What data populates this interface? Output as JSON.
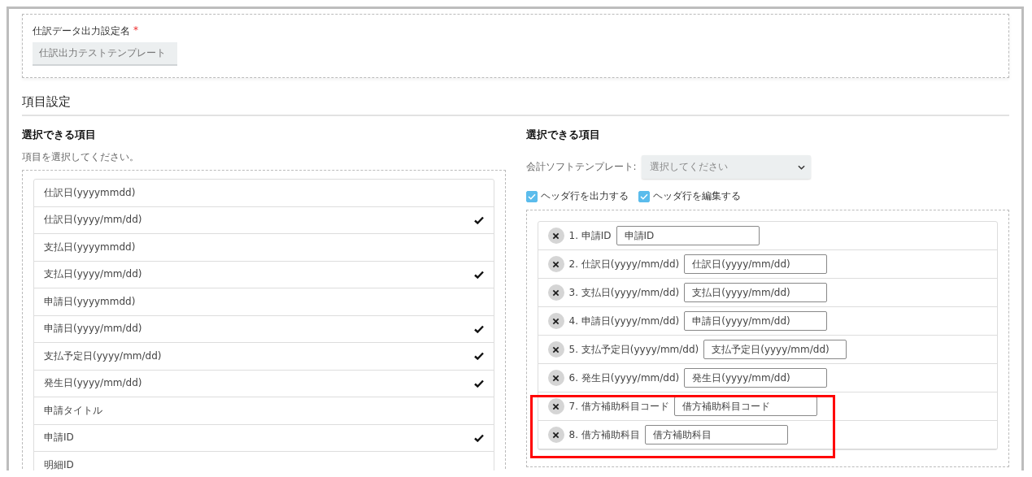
{
  "setting_name": {
    "label": "仕訳データ出力設定名",
    "required_mark": "*",
    "value": "仕訳出力テストテンプレート"
  },
  "section_title": "項目設定",
  "left": {
    "title": "選択できる項目",
    "hint": "項目を選択してください。",
    "items": [
      {
        "label": "仕訳日(yyyymmdd)",
        "checked": false
      },
      {
        "label": "仕訳日(yyyy/mm/dd)",
        "checked": true
      },
      {
        "label": "支払日(yyyymmdd)",
        "checked": false
      },
      {
        "label": "支払日(yyyy/mm/dd)",
        "checked": true
      },
      {
        "label": "申請日(yyyymmdd)",
        "checked": false
      },
      {
        "label": "申請日(yyyy/mm/dd)",
        "checked": true
      },
      {
        "label": "支払予定日(yyyy/mm/dd)",
        "checked": true
      },
      {
        "label": "発生日(yyyy/mm/dd)",
        "checked": true
      },
      {
        "label": "申請タイトル",
        "checked": false
      },
      {
        "label": "申請ID",
        "checked": true
      },
      {
        "label": "明細ID",
        "checked": false
      }
    ]
  },
  "right": {
    "title": "選択できる項目",
    "template_label": "会計ソフトテンプレート:",
    "template_select": {
      "placeholder": "選択してください"
    },
    "options": [
      {
        "label": "ヘッダ行を出力する",
        "checked": true
      },
      {
        "label": "ヘッダ行を編集する",
        "checked": true
      }
    ],
    "fields": [
      {
        "label": "1. 申請ID",
        "value": "申請ID",
        "highlighted": false
      },
      {
        "label": "2. 仕訳日(yyyy/mm/dd)",
        "value": "仕訳日(yyyy/mm/dd)",
        "highlighted": false
      },
      {
        "label": "3. 支払日(yyyy/mm/dd)",
        "value": "支払日(yyyy/mm/dd)",
        "highlighted": false
      },
      {
        "label": "4. 申請日(yyyy/mm/dd)",
        "value": "申請日(yyyy/mm/dd)",
        "highlighted": false
      },
      {
        "label": "5. 支払予定日(yyyy/mm/dd)",
        "value": "支払予定日(yyyy/mm/dd)",
        "highlighted": false
      },
      {
        "label": "6. 発生日(yyyy/mm/dd)",
        "value": "発生日(yyyy/mm/dd)",
        "highlighted": false
      },
      {
        "label": "7. 借方補助科目コード",
        "value": "借方補助科目コード",
        "highlighted": true
      },
      {
        "label": "8. 借方補助科目",
        "value": "借方補助科目",
        "highlighted": true
      }
    ]
  }
}
